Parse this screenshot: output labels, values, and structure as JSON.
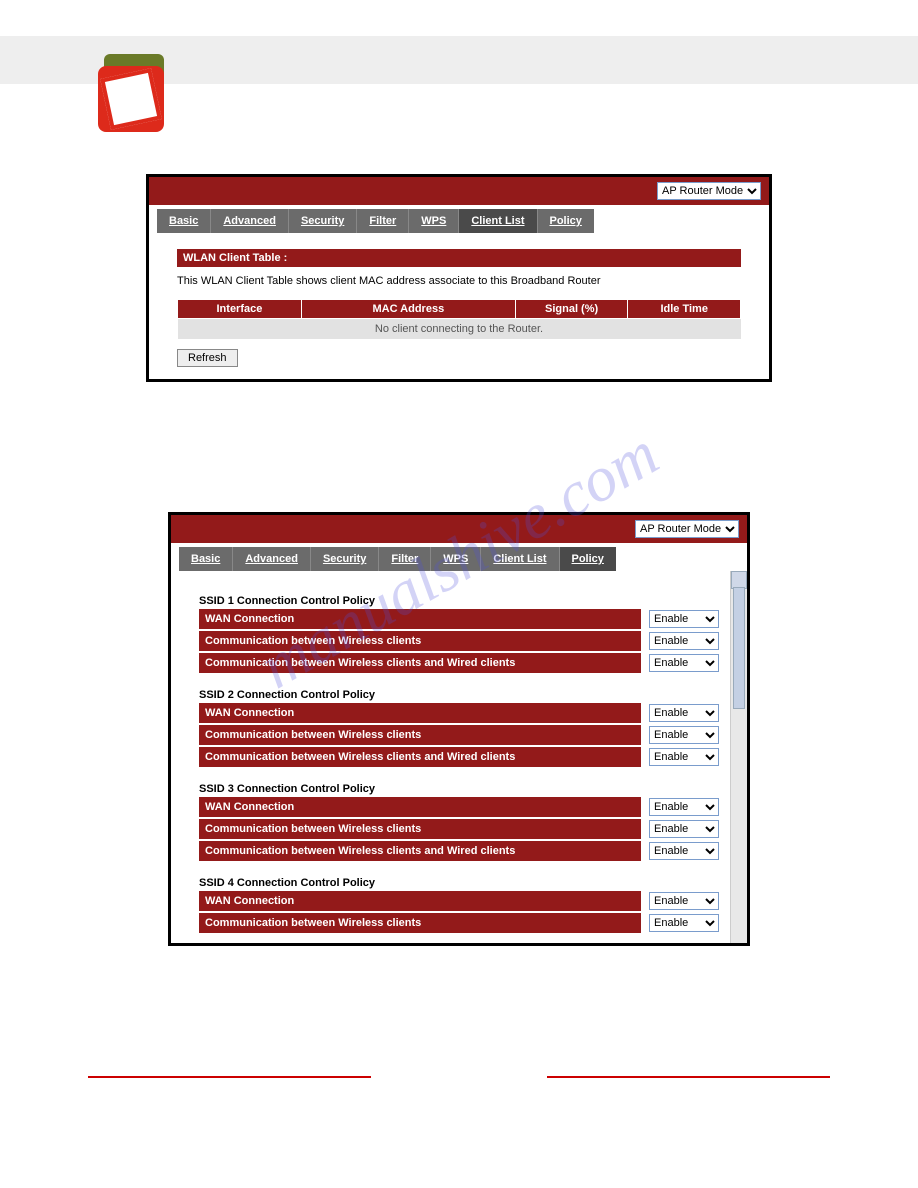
{
  "mode_selector": {
    "value": "AP Router Mode"
  },
  "tabs": {
    "basic": "Basic",
    "advanced": "Advanced",
    "security": "Security",
    "filter": "Filter",
    "wps": "WPS",
    "clientlist": "Client List",
    "policy": "Policy"
  },
  "clientlist": {
    "section_title": "WLAN Client Table :",
    "description": "This WLAN Client Table shows client MAC address associate to this Broadband Router",
    "columns": {
      "c1": "Interface",
      "c2": "MAC Address",
      "c3": "Signal (%)",
      "c4": "Idle Time"
    },
    "empty_msg": "No client connecting to the Router.",
    "refresh": "Refresh"
  },
  "policy": {
    "ssids": [
      {
        "title": "SSID 1 Connection Control Policy",
        "rows": [
          {
            "label": "WAN Connection",
            "value": "Enable"
          },
          {
            "label": "Communication between Wireless clients",
            "value": "Enable"
          },
          {
            "label": "Communication between Wireless clients and Wired clients",
            "value": "Enable"
          }
        ]
      },
      {
        "title": "SSID 2 Connection Control Policy",
        "rows": [
          {
            "label": "WAN Connection",
            "value": "Enable"
          },
          {
            "label": "Communication between Wireless clients",
            "value": "Enable"
          },
          {
            "label": "Communication between Wireless clients and Wired clients",
            "value": "Enable"
          }
        ]
      },
      {
        "title": "SSID 3 Connection Control Policy",
        "rows": [
          {
            "label": "WAN Connection",
            "value": "Enable"
          },
          {
            "label": "Communication between Wireless clients",
            "value": "Enable"
          },
          {
            "label": "Communication between Wireless clients and Wired clients",
            "value": "Enable"
          }
        ]
      },
      {
        "title": "SSID 4 Connection Control Policy",
        "rows": [
          {
            "label": "WAN Connection",
            "value": "Enable"
          },
          {
            "label": "Communication between Wireless clients",
            "value": "Enable"
          }
        ]
      }
    ]
  },
  "watermark": "manualshive.com"
}
